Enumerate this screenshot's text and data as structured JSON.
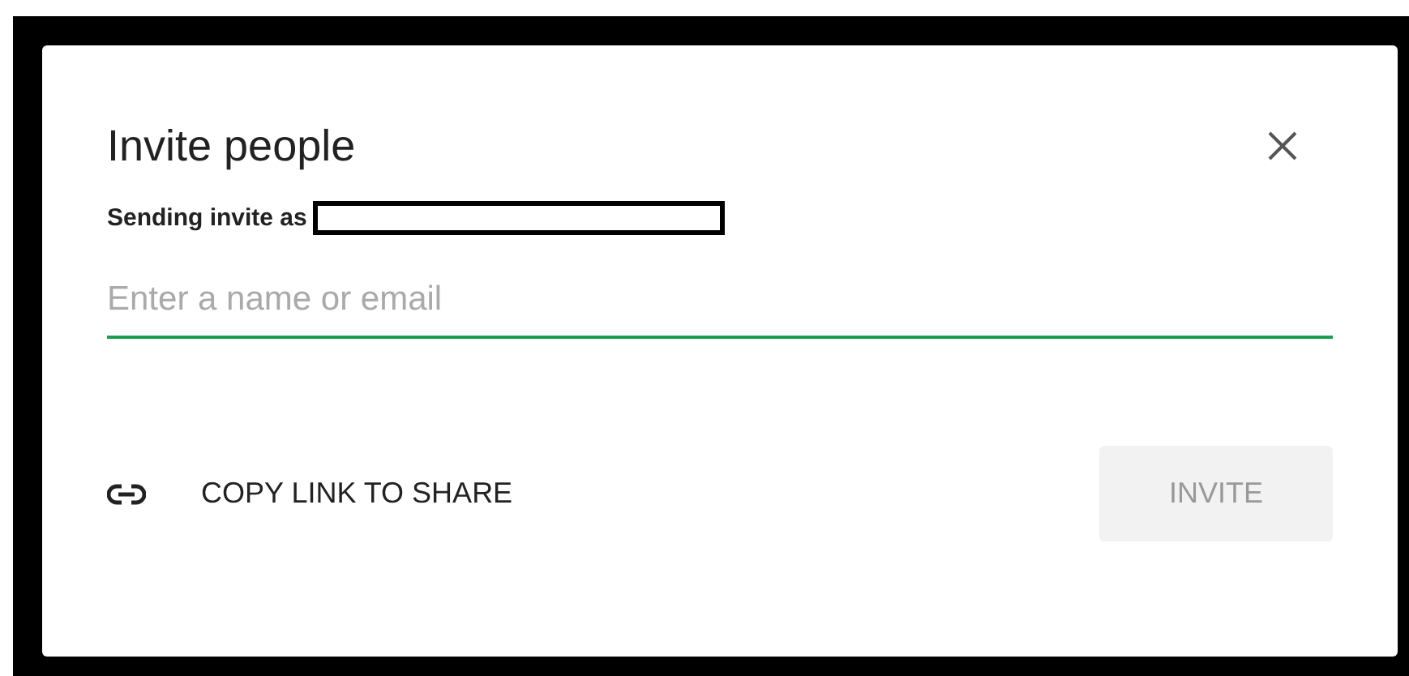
{
  "dialog": {
    "title": "Invite people",
    "sender_label": "Sending invite as",
    "sender_redacted": true
  },
  "input": {
    "placeholder": "Enter a name or email",
    "focused": true
  },
  "copy_link": {
    "label": "COPY LINK TO SHARE"
  },
  "invite_button": {
    "label": "INVITE",
    "disabled": true
  }
}
